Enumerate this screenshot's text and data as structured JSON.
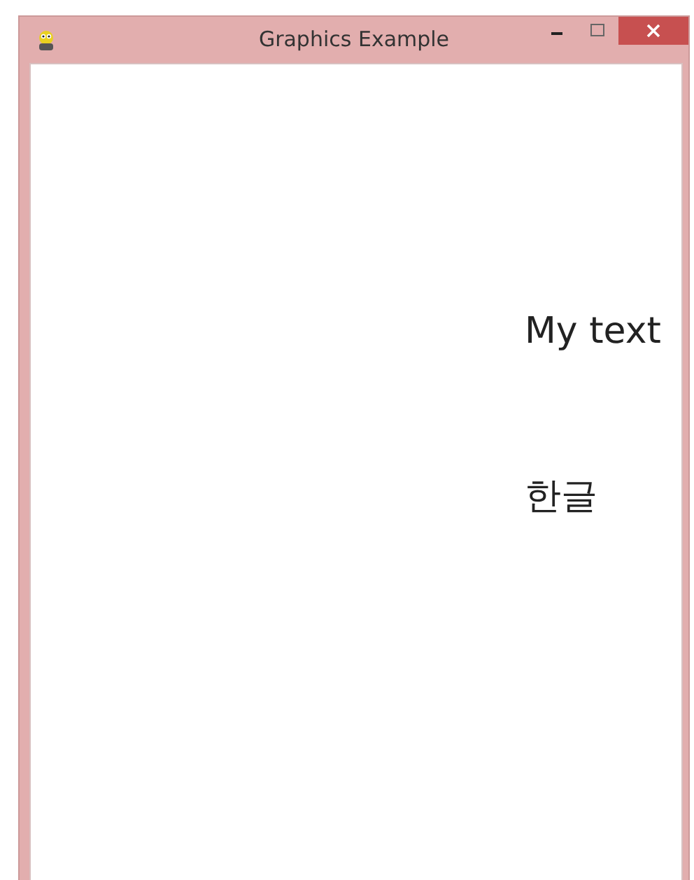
{
  "window": {
    "title": "Graphics Example"
  },
  "canvas": {
    "texts": [
      "My text",
      "한글"
    ]
  }
}
